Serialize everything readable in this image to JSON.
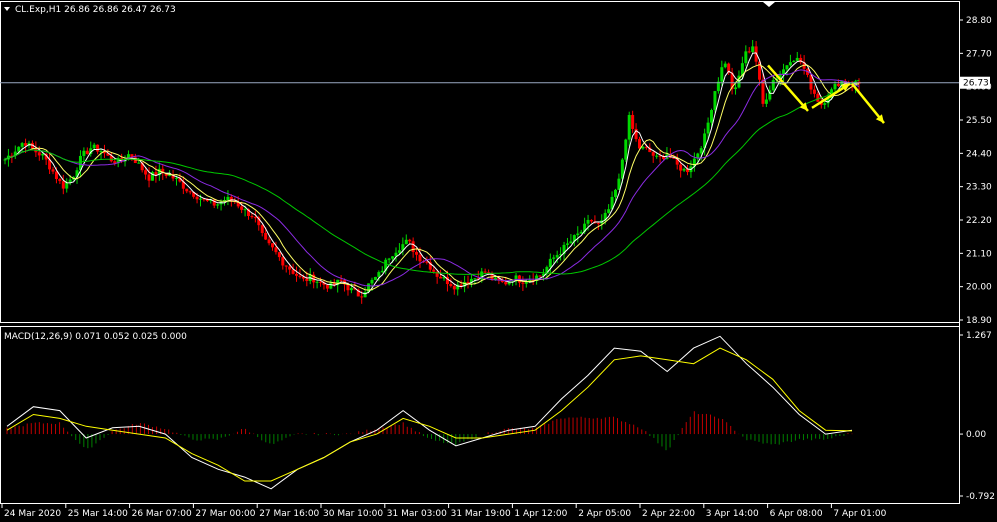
{
  "header": {
    "symbol_line": "CL.Exp,H1  26.86 26.86 26.47 26.73",
    "menu_icon": "triangle-down-icon",
    "corner_icon": "triangle-down-icon"
  },
  "macd": {
    "label": "MACD(12,26,9) 0.071 0.052 0.025 0.000"
  },
  "colors": {
    "background": "#000000",
    "bull_candle": "#00d800",
    "bear_candle": "#ff0000",
    "ma_fast": "#ffffff",
    "ma_mid": "#ffff66",
    "ma_slow": "#8a2be2",
    "ma_long": "#00c800",
    "arrows": "#ffff00",
    "macd_line": "#ffffff",
    "signal_line": "#ffff00",
    "hist_pos": "#c00000",
    "hist_neg": "#008000"
  },
  "chart_data": [
    {
      "type": "candlestick",
      "title": "CL.Exp,H1",
      "price_axis_ticks": [
        "28.80",
        "27.70",
        "26.60",
        "25.50",
        "24.40",
        "23.30",
        "22.20",
        "21.10",
        "20.00",
        "18.90"
      ],
      "ylim": [
        18.9,
        28.8
      ],
      "current_price": "26.73",
      "time_axis_labels": [
        "24 Mar 2020",
        "25 Mar 14:00",
        "26 Mar 07:00",
        "27 Mar 00:00",
        "27 Mar 16:00",
        "30 Mar 10:00",
        "31 Mar 03:00",
        "31 Mar 19:00",
        "1 Apr 12:00",
        "2 Apr 05:00",
        "2 Apr 22:00",
        "3 Apr 14:00",
        "6 Apr 08:00",
        "7 Apr 01:00"
      ],
      "close_path": [
        24.2,
        24.5,
        24.8,
        24.5,
        24.3,
        23.8,
        23.3,
        23.6,
        24.3,
        24.6,
        24.5,
        24.2,
        24.1,
        24.4,
        24.0,
        23.6,
        23.8,
        23.7,
        23.5,
        23.2,
        23.0,
        22.8,
        22.7,
        22.9,
        22.8,
        22.5,
        22.3,
        21.5,
        21.2,
        20.8,
        20.5,
        20.2,
        20.3,
        20.1,
        20.0,
        20.2,
        19.9,
        19.7,
        20.1,
        20.4,
        21.0,
        21.3,
        21.5,
        21.0,
        20.8,
        20.4,
        20.2,
        20.0,
        20.2,
        20.3,
        20.5,
        20.2,
        20.1,
        20.3,
        20.2,
        20.3,
        20.4,
        20.9,
        21.2,
        21.5,
        21.8,
        22.2,
        22.0,
        22.6,
        23.5,
        25.6,
        24.6,
        24.5,
        24.2,
        24.4,
        24.0,
        23.8,
        24.3,
        25.0,
        26.5,
        27.5,
        26.3,
        27.6,
        28.0,
        26.0,
        26.8,
        27.1,
        27.6,
        27.4,
        26.6,
        26.0,
        26.4,
        26.8,
        26.7,
        26.7
      ],
      "moving_averages": [
        {
          "color": "white",
          "trend": "fastest, hugs price"
        },
        {
          "color": "yellow",
          "trend": "fast"
        },
        {
          "color": "purple",
          "trend": "medium"
        },
        {
          "color": "green",
          "trend": "slow, from ~23.3 rising to ~26.0"
        }
      ],
      "annotations": [
        {
          "type": "arrow",
          "from_price": 27.3,
          "to_price": 25.8,
          "direction": "down"
        },
        {
          "type": "arrow",
          "from_price": 25.9,
          "to_price": 26.7,
          "direction": "up"
        },
        {
          "type": "arrow",
          "from_price": 26.7,
          "to_price": 25.4,
          "direction": "down"
        }
      ]
    },
    {
      "type": "line",
      "title": "MACD(12,26,9) 0.071 0.052 0.025 0.000",
      "axis_ticks": [
        "1.267",
        "0.00",
        "-0.792"
      ],
      "ylim": [
        -0.792,
        1.267
      ],
      "series": [
        {
          "values": [
            0.1,
            0.35,
            0.3,
            -0.05,
            0.08,
            0.1,
            0.0,
            -0.3,
            -0.45,
            -0.55,
            -0.7,
            -0.45,
            -0.3,
            -0.1,
            0.05,
            0.3,
            0.05,
            -0.15,
            -0.05,
            0.05,
            0.1,
            0.45,
            0.75,
            1.1,
            1.06,
            0.8,
            1.1,
            1.25,
            0.9,
            0.6,
            0.25,
            0.0,
            0.05
          ]
        },
        {
          "values": [
            0.05,
            0.25,
            0.2,
            0.1,
            0.05,
            0.0,
            -0.05,
            -0.25,
            -0.4,
            -0.6,
            -0.6,
            -0.45,
            -0.3,
            -0.1,
            0.0,
            0.2,
            0.1,
            -0.05,
            -0.05,
            0.0,
            0.05,
            0.3,
            0.6,
            0.95,
            1.0,
            0.95,
            0.9,
            1.1,
            0.95,
            0.7,
            0.3,
            0.05,
            0.04
          ]
        }
      ],
      "histogram_trend": "red positive bars around the rally, green negative bars in pullbacks"
    }
  ]
}
